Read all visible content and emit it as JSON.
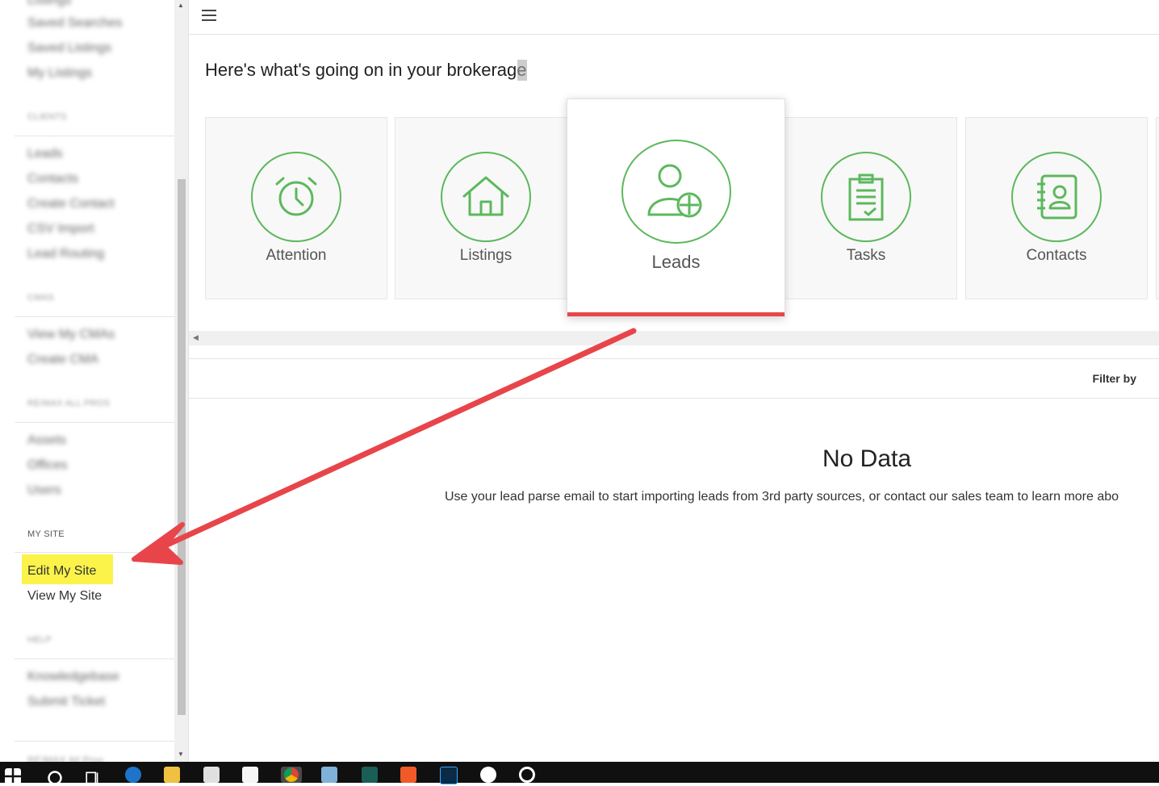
{
  "sidebar": {
    "top_items": [
      "Listings",
      "Saved Searches",
      "Saved Listings",
      "My Listings"
    ],
    "clients_heading": "CLIENTS",
    "clients_items": [
      "Leads",
      "Contacts",
      "Create Contact",
      "CSV Import",
      "Lead Routing"
    ],
    "cmas_heading": "CMAS",
    "cmas_items": [
      "View My CMAs",
      "Create CMA"
    ],
    "remax_heading": "RE/MAX ALL PROS",
    "remax_items": [
      "Assets",
      "Offices",
      "Users"
    ],
    "my_site_heading": "MY SITE",
    "my_site_items": [
      "Edit My Site",
      "View My Site"
    ],
    "help_heading": "HELP",
    "help_items": [
      "Knowledgebase",
      "Submit Ticket"
    ],
    "footer": "RE/MAX All Pros"
  },
  "main": {
    "headline": "Here's what's going on in your brokerage",
    "cards": [
      {
        "label": "Attention",
        "icon": "alarm-clock-icon"
      },
      {
        "label": "Listings",
        "icon": "house-icon"
      },
      {
        "label": "Leads",
        "icon": "user-target-icon"
      },
      {
        "label": "Tasks",
        "icon": "clipboard-checklist-icon"
      },
      {
        "label": "Contacts",
        "icon": "address-book-icon"
      }
    ],
    "active_card": "Leads",
    "filter_label": "Filter by",
    "no_data_title": "No Data",
    "no_data_message": "Use your lead parse email to start importing leads from 3rd party sources, or contact our sales team to learn more abo"
  },
  "colors": {
    "accent_green": "#5cb85c",
    "active_underline": "#e8464b",
    "highlight": "#fbf34a",
    "annotation_arrow": "#e8454a"
  },
  "taskbar": {
    "icons": [
      "windows-start-icon",
      "search-icon",
      "task-view-icon",
      "edge-icon",
      "file-explorer-icon",
      "store-icon",
      "mail-icon",
      "chrome-icon",
      "eraser-app-icon",
      "sumatra-icon",
      "snagit-icon",
      "photoshop-icon",
      "slack-icon",
      "camera-app-icon"
    ]
  }
}
